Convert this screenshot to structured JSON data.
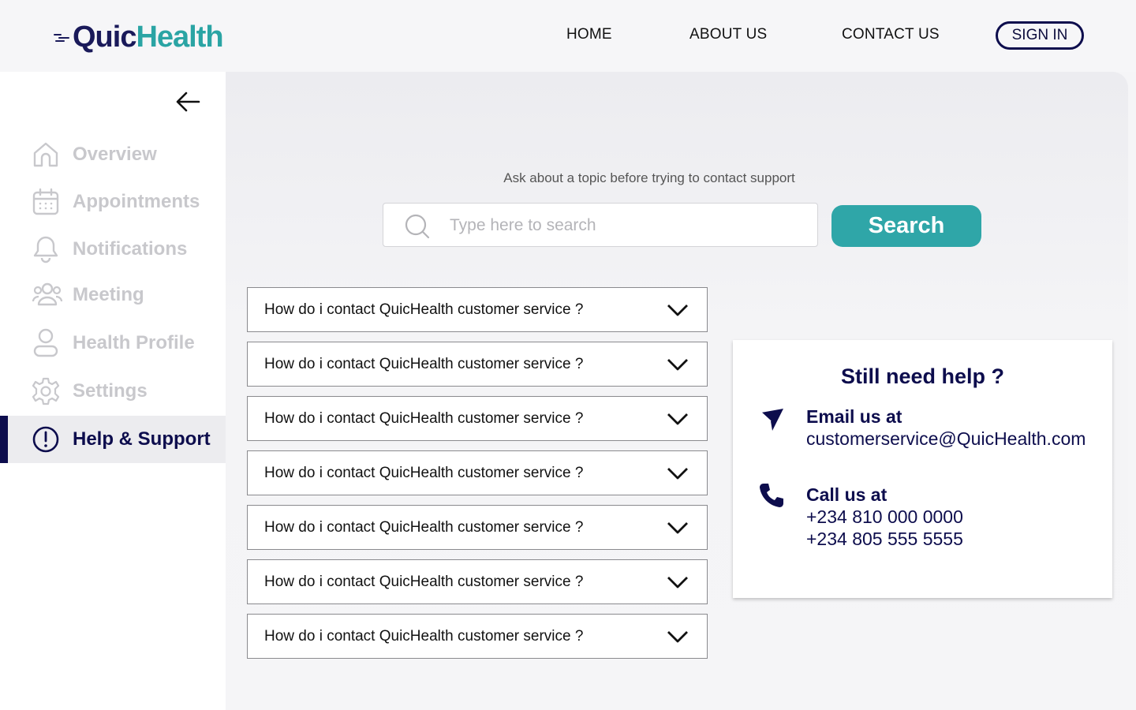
{
  "brand": {
    "part1": "Quic",
    "part2": "Health",
    "color_primary": "#1a1a5a",
    "color_accent": "#2aa4a4"
  },
  "nav": {
    "home": "HOME",
    "about": "ABOUT US",
    "contact": "CONTACT US",
    "signin": "SIGN IN"
  },
  "sidebar": {
    "back_icon": "arrow-left-icon",
    "items": [
      {
        "label": "Overview",
        "icon": "home-icon",
        "active": false
      },
      {
        "label": "Appointments",
        "icon": "calendar-icon",
        "active": false
      },
      {
        "label": "Notifications",
        "icon": "bell-icon",
        "active": false
      },
      {
        "label": "Meeting",
        "icon": "users-icon",
        "active": false
      },
      {
        "label": "Health Profile",
        "icon": "user-icon",
        "active": false
      },
      {
        "label": "Settings",
        "icon": "gear-icon",
        "active": false
      },
      {
        "label": "Help & Support",
        "icon": "alert-circle-icon",
        "active": true
      }
    ]
  },
  "search": {
    "prompt": "Ask about a topic before trying to contact support",
    "placeholder": "Type here to search",
    "value": "",
    "button_label": "Search"
  },
  "faqs": [
    {
      "question": "How do i contact QuicHealth customer service ?"
    },
    {
      "question": "How do i contact QuicHealth customer service ?"
    },
    {
      "question": "How do i contact QuicHealth customer service ?"
    },
    {
      "question": "How do i contact QuicHealth customer service ?"
    },
    {
      "question": "How do i contact QuicHealth customer service ?"
    },
    {
      "question": "How do i contact QuicHealth customer service ?"
    },
    {
      "question": "How do i contact QuicHealth customer service ?"
    }
  ],
  "help": {
    "title": "Still need help ?",
    "email_heading": "Email us at",
    "email": "customerservice@QuicHealth.com",
    "call_heading": "Call us at",
    "phone1": "+234 810 000 0000",
    "phone2": "+234 805 555 5555"
  }
}
